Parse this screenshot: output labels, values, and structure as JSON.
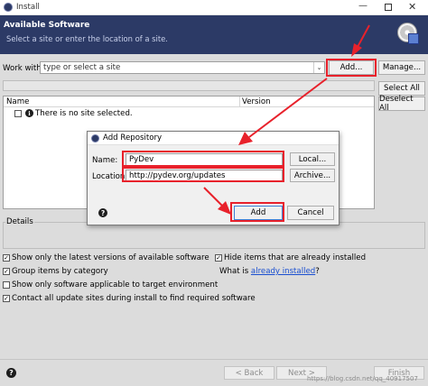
{
  "window": {
    "title": "Install",
    "brand_color": "#2c3a66"
  },
  "header": {
    "title": "Available Software",
    "subtitle": "Select a site or enter the location of a site."
  },
  "work_with": {
    "label": "Work with:",
    "placeholder": "type or select a site",
    "add_label": "Add...",
    "manage_label": "Manage..."
  },
  "table": {
    "col_name": "Name",
    "col_version": "Version",
    "empty_text": "There is no site selected."
  },
  "side_buttons": {
    "select_all": "Select All",
    "deselect_all": "Deselect All"
  },
  "details": {
    "label": "Details"
  },
  "options": {
    "latest": "Show only the latest versions of available software",
    "hide_installed": "Hide items that are already installed",
    "group": "Group items by category",
    "what_is": "What is",
    "already_installed_link": "already installed",
    "what_is_suffix": "?",
    "applicable": "Show only software applicable to target environment",
    "contact": "Contact all update sites during install to find required software"
  },
  "footer": {
    "back": "< Back",
    "next": "Next >",
    "finish": "Finish",
    "watermark": "https://blog.csdn.net/qq_40917507"
  },
  "dialog": {
    "title": "Add Repository",
    "name_label": "Name:",
    "name_value": "PyDev",
    "local_label": "Local...",
    "location_label": "Location:",
    "location_value": "http://pydev.org/updates",
    "archive_label": "Archive...",
    "add_label": "Add",
    "cancel_label": "Cancel"
  }
}
